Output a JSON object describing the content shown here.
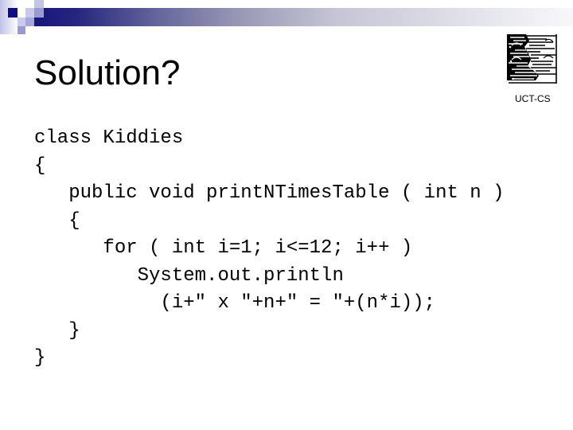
{
  "slide": {
    "title": "Solution?",
    "logo": {
      "icon": "uct-cs-logo-icon",
      "caption": "UCT-CS"
    },
    "code": {
      "language": "java",
      "lines": [
        "class Kiddies",
        "{",
        "   public void printNTimesTable ( int n )",
        "   {",
        "      for ( int i=1; i<=12; i++ )",
        "         System.out.println",
        "           (i+\" x \"+n+\" = \"+(n*i));",
        "   }",
        "}"
      ]
    },
    "theme": {
      "accent_navy": "#16167c",
      "accent_lavender": "#c8c8ec",
      "text": "#000000",
      "background": "#ffffff"
    }
  }
}
